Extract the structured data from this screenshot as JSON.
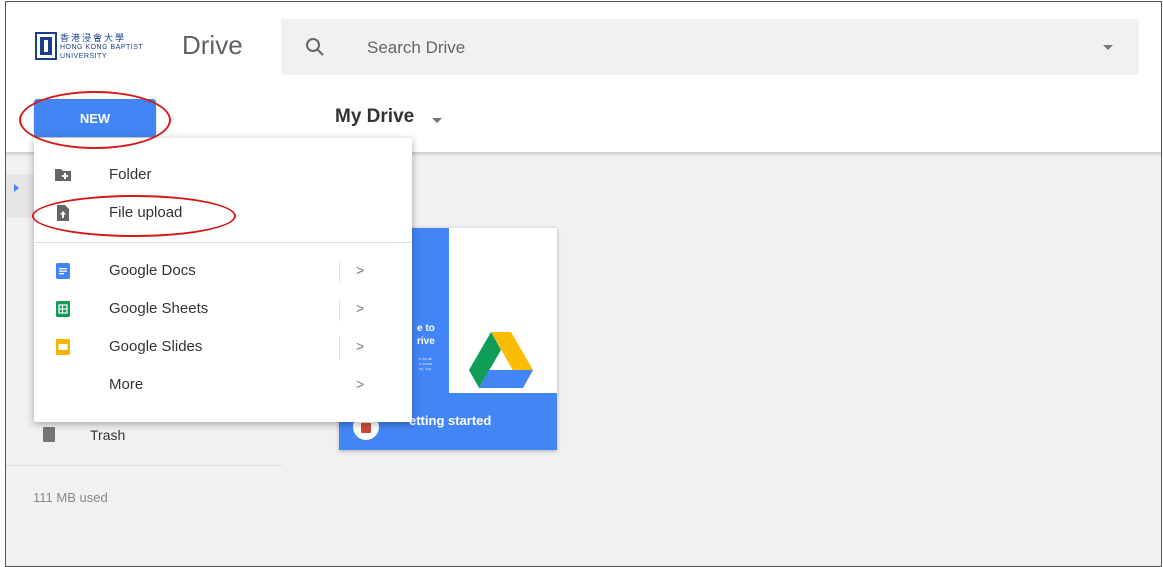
{
  "header": {
    "logo_text_zh": "香港浸會大學",
    "logo_text_en": "HONG KONG BAPTIST UNIVERSITY",
    "app_title": "Drive",
    "search_placeholder": "Search Drive"
  },
  "toolbar": {
    "new_label": "NEW",
    "location_label": "My Drive"
  },
  "new_menu": {
    "items": [
      {
        "label": "Folder",
        "icon": "folder-plus-icon"
      },
      {
        "label": "File upload",
        "icon": "file-upload-icon"
      },
      {
        "label": "Google Docs",
        "icon": "google-docs-icon",
        "chevron": ">"
      },
      {
        "label": "Google Sheets",
        "icon": "google-sheets-icon",
        "chevron": ">"
      },
      {
        "label": "Google Slides",
        "icon": "google-slides-icon",
        "chevron": ">"
      },
      {
        "label": "More",
        "icon": "",
        "chevron": ">"
      }
    ]
  },
  "sidebar": {
    "trash_label": "Trash",
    "storage_used": "111 MB used"
  },
  "welcome_card": {
    "title_fragment": "e to\nrive",
    "small_text": "e for all\nd some\nns, too.",
    "footer_label": "etting started"
  },
  "colors": {
    "accent": "#4285f4",
    "annotation": "#d61a1a",
    "docs": "#4285f4",
    "sheets": "#0f9d58",
    "slides": "#f4b400"
  }
}
